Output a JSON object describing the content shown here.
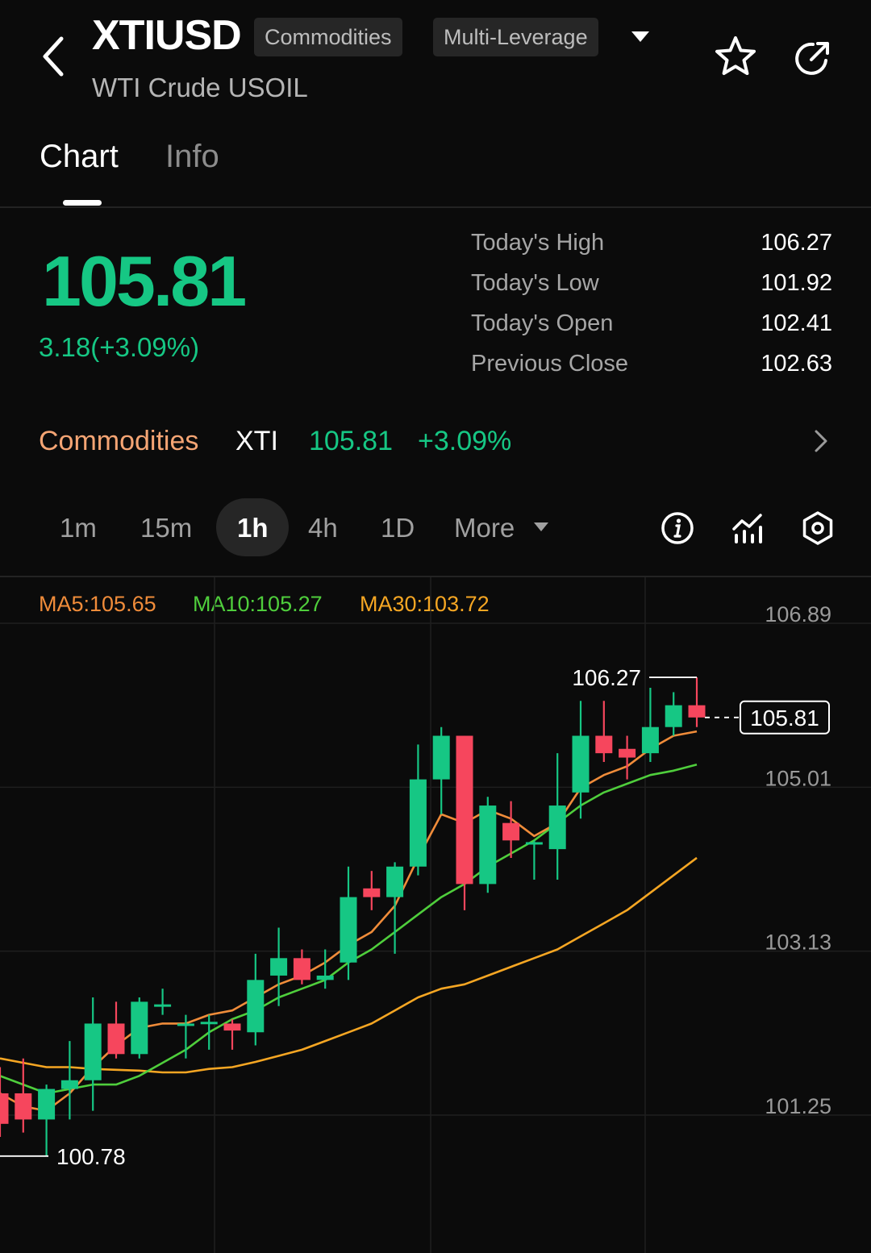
{
  "header": {
    "symbol": "XTIUSD",
    "tags": [
      "Commodities",
      "Multi-Leverage"
    ],
    "subtitle": "WTI Crude USOIL"
  },
  "tabs": [
    {
      "label": "Chart",
      "active": true
    },
    {
      "label": "Info",
      "active": false
    }
  ],
  "quote": {
    "price": "105.81",
    "change": "3.18(+3.09%)",
    "up_color": "#16c784",
    "down_color": "#f6465d",
    "stats": [
      {
        "label": "Today's High",
        "value": "106.27"
      },
      {
        "label": "Today's Low",
        "value": "101.92"
      },
      {
        "label": "Today's Open",
        "value": "102.41"
      },
      {
        "label": "Previous Close",
        "value": "102.63"
      }
    ]
  },
  "market_row": {
    "category": "Commodities",
    "symbol": "XTI",
    "price": "105.81",
    "change_pct": "+3.09%"
  },
  "intervals": {
    "items": [
      "1m",
      "15m",
      "1h",
      "4h",
      "1D"
    ],
    "selected": "1h",
    "more_label": "More"
  },
  "toolbar_icons": [
    "info-icon",
    "indicator-icon",
    "settings-icon"
  ],
  "moving_averages": [
    {
      "label": "MA5:105.65",
      "color": "#f08c3a"
    },
    {
      "label": "MA10:105.27",
      "color": "#4fce3c"
    },
    {
      "label": "MA30:103.72",
      "color": "#f5a623"
    }
  ],
  "chart_data": {
    "type": "candlestick",
    "y_ticks": [
      "106.89",
      "105.01",
      "103.13",
      "101.25"
    ],
    "ylim": [
      100.3,
      107.2
    ],
    "high_marker": "106.27",
    "low_marker": "100.78",
    "current_price_label": "105.81",
    "candles": [
      {
        "o": 101.5,
        "h": 101.8,
        "l": 101.0,
        "c": 101.15
      },
      {
        "o": 101.5,
        "h": 101.9,
        "l": 101.05,
        "c": 101.2
      },
      {
        "o": 101.2,
        "h": 101.6,
        "l": 100.78,
        "c": 101.55
      },
      {
        "o": 101.55,
        "h": 102.1,
        "l": 101.2,
        "c": 101.65
      },
      {
        "o": 101.65,
        "h": 102.6,
        "l": 101.3,
        "c": 102.3
      },
      {
        "o": 102.3,
        "h": 102.55,
        "l": 101.9,
        "c": 101.95
      },
      {
        "o": 101.95,
        "h": 102.6,
        "l": 101.9,
        "c": 102.55
      },
      {
        "o": 102.5,
        "h": 102.7,
        "l": 102.4,
        "c": 102.52
      },
      {
        "o": 102.3,
        "h": 102.4,
        "l": 101.9,
        "c": 102.3
      },
      {
        "o": 102.3,
        "h": 102.4,
        "l": 102.0,
        "c": 102.32
      },
      {
        "o": 102.3,
        "h": 102.35,
        "l": 102.0,
        "c": 102.22
      },
      {
        "o": 102.2,
        "h": 103.1,
        "l": 102.05,
        "c": 102.8
      },
      {
        "o": 102.85,
        "h": 103.4,
        "l": 102.5,
        "c": 103.05
      },
      {
        "o": 103.05,
        "h": 103.15,
        "l": 102.75,
        "c": 102.8
      },
      {
        "o": 102.8,
        "h": 103.15,
        "l": 102.7,
        "c": 102.85
      },
      {
        "o": 103.0,
        "h": 104.1,
        "l": 102.8,
        "c": 103.75
      },
      {
        "o": 103.85,
        "h": 104.05,
        "l": 103.6,
        "c": 103.75
      },
      {
        "o": 103.75,
        "h": 104.15,
        "l": 103.1,
        "c": 104.1
      },
      {
        "o": 104.1,
        "h": 105.5,
        "l": 104.0,
        "c": 105.1
      },
      {
        "o": 105.1,
        "h": 105.7,
        "l": 104.7,
        "c": 105.6
      },
      {
        "o": 105.6,
        "h": 105.6,
        "l": 103.6,
        "c": 103.9
      },
      {
        "o": 103.9,
        "h": 104.9,
        "l": 103.8,
        "c": 104.8
      },
      {
        "o": 104.6,
        "h": 104.85,
        "l": 104.2,
        "c": 104.4
      },
      {
        "o": 104.37,
        "h": 104.4,
        "l": 103.95,
        "c": 104.38
      },
      {
        "o": 104.3,
        "h": 105.4,
        "l": 103.95,
        "c": 104.8
      },
      {
        "o": 104.95,
        "h": 106.0,
        "l": 104.65,
        "c": 105.6
      },
      {
        "o": 105.6,
        "h": 106.0,
        "l": 105.3,
        "c": 105.4
      },
      {
        "o": 105.45,
        "h": 105.6,
        "l": 105.1,
        "c": 105.35
      },
      {
        "o": 105.4,
        "h": 106.15,
        "l": 105.3,
        "c": 105.7
      },
      {
        "o": 105.7,
        "h": 106.1,
        "l": 105.6,
        "c": 105.95
      },
      {
        "o": 105.95,
        "h": 106.27,
        "l": 105.7,
        "c": 105.81
      }
    ],
    "ma5": [
      101.5,
      101.35,
      101.3,
      101.5,
      101.8,
      102.05,
      102.25,
      102.3,
      102.3,
      102.4,
      102.45,
      102.6,
      102.75,
      102.85,
      103.0,
      103.2,
      103.35,
      103.65,
      104.2,
      104.7,
      104.6,
      104.75,
      104.65,
      104.45,
      104.6,
      105.0,
      105.15,
      105.25,
      105.45,
      105.6,
      105.65
    ],
    "ma10": [
      101.7,
      101.6,
      101.5,
      101.55,
      101.6,
      101.6,
      101.7,
      101.85,
      102.0,
      102.2,
      102.35,
      102.45,
      102.6,
      102.7,
      102.8,
      103.0,
      103.15,
      103.35,
      103.55,
      103.75,
      103.9,
      104.1,
      104.25,
      104.4,
      104.6,
      104.8,
      104.95,
      105.05,
      105.15,
      105.2,
      105.27
    ],
    "ma30": [
      101.9,
      101.85,
      101.8,
      101.8,
      101.78,
      101.77,
      101.76,
      101.74,
      101.74,
      101.78,
      101.8,
      101.86,
      101.93,
      102.0,
      102.1,
      102.2,
      102.3,
      102.45,
      102.6,
      102.7,
      102.75,
      102.85,
      102.95,
      103.05,
      103.15,
      103.3,
      103.45,
      103.6,
      103.8,
      104.0,
      104.2
    ]
  }
}
